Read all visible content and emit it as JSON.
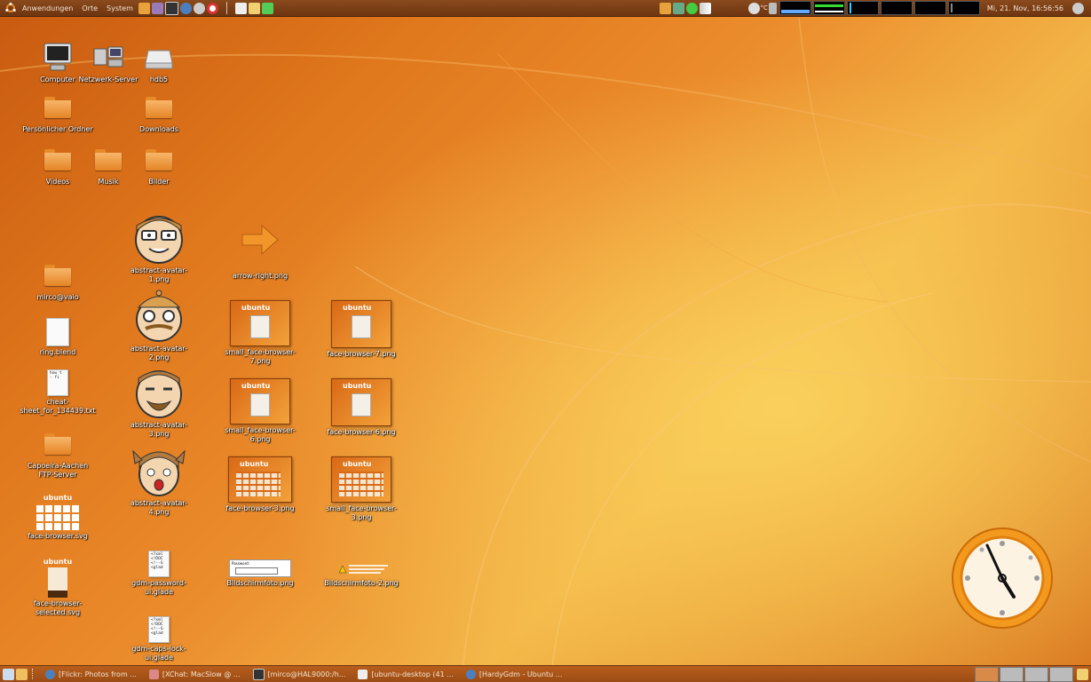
{
  "top_panel": {
    "menus": [
      "Anwendungen",
      "Orte",
      "System"
    ],
    "temperature": "°C",
    "datetime": "Mi, 21. Nov, 16:56:56"
  },
  "desktop_icons": [
    {
      "label": "Computer",
      "kind": "computer"
    },
    {
      "label": "Netzwerk-Server",
      "kind": "network"
    },
    {
      "label": "hdb5",
      "kind": "drive"
    },
    {
      "label": "Persönlicher Ordner",
      "kind": "home-folder"
    },
    {
      "label": "Downloads",
      "kind": "folder"
    },
    {
      "label": "Videos",
      "kind": "folder"
    },
    {
      "label": "Musik",
      "kind": "folder"
    },
    {
      "label": "Bilder",
      "kind": "folder"
    },
    {
      "label": "abstract-avatar-1.png",
      "kind": "avatar"
    },
    {
      "label": "arrow-right.png",
      "kind": "arrow"
    },
    {
      "label": "mirco@vaio",
      "kind": "folder"
    },
    {
      "label": "abstract-avatar-2.png",
      "kind": "avatar"
    },
    {
      "label": "small_face-browser-7.png",
      "kind": "thumb"
    },
    {
      "label": "face-browser-7.png",
      "kind": "thumb"
    },
    {
      "label": "ring.blend",
      "kind": "file"
    },
    {
      "label": "cheat-sheet_for_134439.txt",
      "kind": "text"
    },
    {
      "label": "abstract-avatar-3.png",
      "kind": "avatar"
    },
    {
      "label": "small_face-browser-6.png",
      "kind": "thumb"
    },
    {
      "label": "face-browser-6.png",
      "kind": "thumb"
    },
    {
      "label": "Capoeira-Aachen FTP-Server",
      "kind": "folder"
    },
    {
      "label": "abstract-avatar-4.png",
      "kind": "avatar"
    },
    {
      "label": "face-browser-3.png",
      "kind": "thumb-grid"
    },
    {
      "label": "small_face-browser-3.png",
      "kind": "thumb-grid"
    },
    {
      "label": "face-browser.svg",
      "kind": "ubuntu-grid"
    },
    {
      "label": "face-browser-selected.svg",
      "kind": "ubuntu-file"
    },
    {
      "label": "gdm-password-ui.glade",
      "kind": "xml"
    },
    {
      "label": "Bildschirmfoto.png",
      "kind": "screenshot"
    },
    {
      "label": "Bildschirmfoto-2.png",
      "kind": "screenshot2"
    },
    {
      "label": "gdm-caps-lock-ui.glade",
      "kind": "xml"
    }
  ],
  "text_file_preview": "how t\n- fi",
  "xml_file_preview": "<?xml\n<!DOC\n<!--G\n<glad",
  "thumb_logo": "ubuntu",
  "screenshot_label": "Password:",
  "taskbar": {
    "tasks": [
      "[Flickr: Photos from ...",
      "[XChat: MacSlow @ ...",
      "[mirco@HAL9000:/h...",
      "[ubuntu-desktop (41 ...",
      "[HardyGdm - Ubuntu ..."
    ]
  },
  "colors": {
    "panel_top": "#7d3f14",
    "panel_bottom": "#a9561a",
    "accent": "#e8801f"
  }
}
